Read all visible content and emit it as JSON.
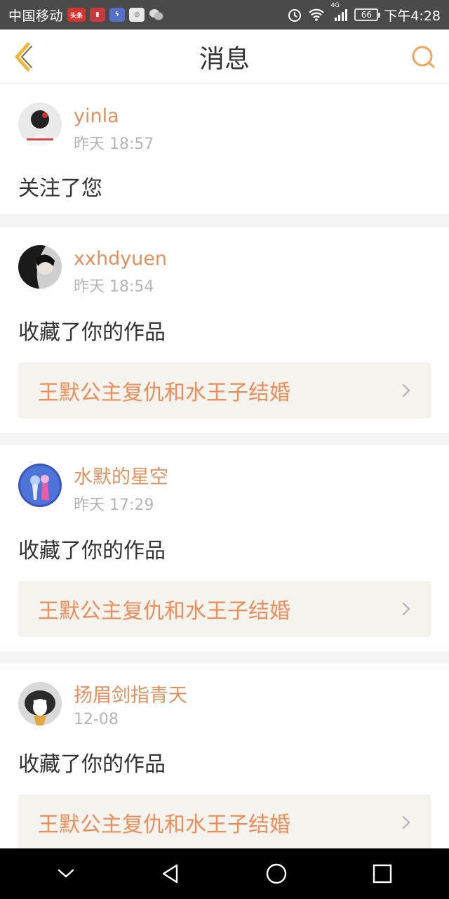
{
  "status_bar": {
    "carrier": "中国移动",
    "network": "4G",
    "battery": "66",
    "time": "下午4:28",
    "app_badge": "头条"
  },
  "header": {
    "title": "消息",
    "back_icon": "chevron-left-icon",
    "search_icon": "search-icon"
  },
  "messages": [
    {
      "username": "yinla",
      "time": "昨天 18:57",
      "action": "关注了您",
      "work_title": null
    },
    {
      "username": "xxhdyuen",
      "time": "昨天 18:54",
      "action": "收藏了你的作品",
      "work_title": "王默公主复仇和水王子结婚"
    },
    {
      "username": "水默的星空",
      "time": "昨天 17:29",
      "action": "收藏了你的作品",
      "work_title": "王默公主复仇和水王子结婚"
    },
    {
      "username": "扬眉剑指青天",
      "time": "12-08",
      "action": "收藏了你的作品",
      "work_title": "王默公主复仇和水王子结婚"
    }
  ],
  "colors": {
    "accent": "#e3905f",
    "status_bar_bg": "#4a4a4a"
  }
}
